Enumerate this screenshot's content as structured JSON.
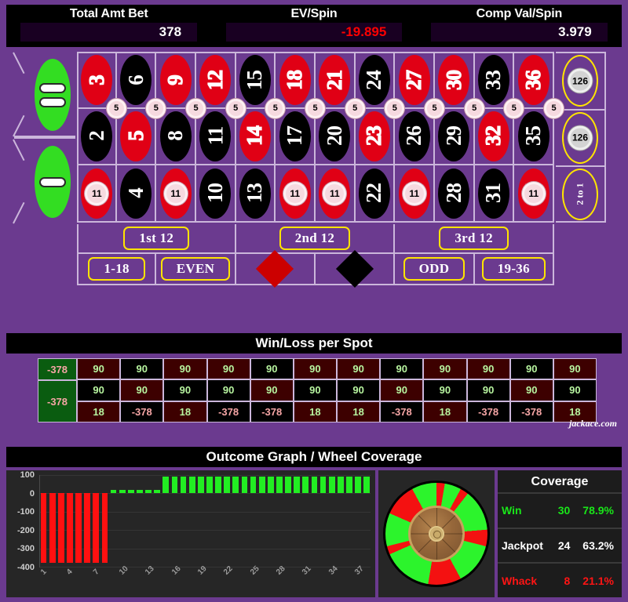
{
  "header": {
    "stats": [
      {
        "label": "Total Amt Bet",
        "value": "378",
        "negative": false
      },
      {
        "label": "EV/Spin",
        "value": "-19.895",
        "negative": true
      },
      {
        "label": "Comp Val/Spin",
        "value": "3.979",
        "negative": false
      }
    ]
  },
  "table": {
    "zeros": [
      {
        "name": "double-zero",
        "pips": 2
      },
      {
        "name": "single-zero",
        "pips": 1
      }
    ],
    "numbers": [
      {
        "n": "3",
        "color": "red",
        "chip": "5",
        "chipType": "split"
      },
      {
        "n": "6",
        "color": "black",
        "chip": "5",
        "chipType": "split"
      },
      {
        "n": "9",
        "color": "red",
        "chip": "5",
        "chipType": "split"
      },
      {
        "n": "12",
        "color": "red",
        "chip": "5",
        "chipType": "split"
      },
      {
        "n": "15",
        "color": "black",
        "chip": "5",
        "chipType": "split"
      },
      {
        "n": "18",
        "color": "red",
        "chip": "5",
        "chipType": "split"
      },
      {
        "n": "21",
        "color": "red",
        "chip": "5",
        "chipType": "split"
      },
      {
        "n": "24",
        "color": "black",
        "chip": "5",
        "chipType": "split"
      },
      {
        "n": "27",
        "color": "red",
        "chip": "5",
        "chipType": "split"
      },
      {
        "n": "30",
        "color": "red",
        "chip": "5",
        "chipType": "split"
      },
      {
        "n": "33",
        "color": "black",
        "chip": "5",
        "chipType": "split"
      },
      {
        "n": "36",
        "color": "red",
        "chip": "5",
        "chipType": "split"
      },
      {
        "n": "2",
        "color": "black",
        "chip": null,
        "chipType": null
      },
      {
        "n": "5",
        "color": "red",
        "chip": null,
        "chipType": null
      },
      {
        "n": "8",
        "color": "black",
        "chip": null,
        "chipType": null
      },
      {
        "n": "11",
        "color": "black",
        "chip": null,
        "chipType": null
      },
      {
        "n": "14",
        "color": "red",
        "chip": null,
        "chipType": null
      },
      {
        "n": "17",
        "color": "black",
        "chip": null,
        "chipType": null
      },
      {
        "n": "20",
        "color": "black",
        "chip": null,
        "chipType": null
      },
      {
        "n": "23",
        "color": "red",
        "chip": null,
        "chipType": null
      },
      {
        "n": "26",
        "color": "black",
        "chip": null,
        "chipType": null
      },
      {
        "n": "29",
        "color": "black",
        "chip": null,
        "chipType": null
      },
      {
        "n": "32",
        "color": "red",
        "chip": null,
        "chipType": null
      },
      {
        "n": "35",
        "color": "black",
        "chip": null,
        "chipType": null
      },
      {
        "n": "1",
        "color": "red",
        "chip": "11",
        "chipType": "center"
      },
      {
        "n": "4",
        "color": "black",
        "chip": null,
        "chipType": null
      },
      {
        "n": "7",
        "color": "red",
        "chip": "11",
        "chipType": "center"
      },
      {
        "n": "10",
        "color": "black",
        "chip": null,
        "chipType": null
      },
      {
        "n": "13",
        "color": "black",
        "chip": null,
        "chipType": null
      },
      {
        "n": "16",
        "color": "red",
        "chip": "11",
        "chipType": "center"
      },
      {
        "n": "19",
        "color": "red",
        "chip": "11",
        "chipType": "center"
      },
      {
        "n": "22",
        "color": "black",
        "chip": null,
        "chipType": null
      },
      {
        "n": "25",
        "color": "red",
        "chip": "11",
        "chipType": "center"
      },
      {
        "n": "28",
        "color": "black",
        "chip": null,
        "chipType": null
      },
      {
        "n": "31",
        "color": "black",
        "chip": null,
        "chipType": null
      },
      {
        "n": "34",
        "color": "red",
        "chip": "11",
        "chipType": "center"
      }
    ],
    "column_bets": [
      {
        "label": "2 to 1",
        "chip": "126"
      },
      {
        "label": "2 to 1",
        "chip": "126"
      },
      {
        "label": "2 to 1",
        "chip": null
      }
    ],
    "dozens": [
      {
        "label": "1st 12"
      },
      {
        "label": "2nd 12"
      },
      {
        "label": "3rd 12"
      }
    ],
    "outside": [
      {
        "label": "1-18",
        "type": "text"
      },
      {
        "label": "EVEN",
        "type": "text"
      },
      {
        "label": "RED",
        "type": "diamond-red"
      },
      {
        "label": "BLACK",
        "type": "diamond-black"
      },
      {
        "label": "ODD",
        "type": "text"
      },
      {
        "label": "19-36",
        "type": "text"
      }
    ]
  },
  "winloss": {
    "title": "Win/Loss per Spot",
    "zero_cells": [
      {
        "value": "-378"
      },
      {
        "value": "-378"
      }
    ],
    "columns": [
      {
        "cells": [
          {
            "value": "90",
            "color": "red",
            "sign": "pos"
          },
          {
            "value": "90",
            "color": "black",
            "sign": "pos"
          },
          {
            "value": "18",
            "color": "red",
            "sign": "pos"
          }
        ]
      },
      {
        "cells": [
          {
            "value": "90",
            "color": "black",
            "sign": "pos"
          },
          {
            "value": "90",
            "color": "red",
            "sign": "pos"
          },
          {
            "value": "-378",
            "color": "black",
            "sign": "neg"
          }
        ]
      },
      {
        "cells": [
          {
            "value": "90",
            "color": "red",
            "sign": "pos"
          },
          {
            "value": "90",
            "color": "black",
            "sign": "pos"
          },
          {
            "value": "18",
            "color": "red",
            "sign": "pos"
          }
        ]
      },
      {
        "cells": [
          {
            "value": "90",
            "color": "red",
            "sign": "pos"
          },
          {
            "value": "90",
            "color": "black",
            "sign": "pos"
          },
          {
            "value": "-378",
            "color": "black",
            "sign": "neg"
          }
        ]
      },
      {
        "cells": [
          {
            "value": "90",
            "color": "black",
            "sign": "pos"
          },
          {
            "value": "90",
            "color": "red",
            "sign": "pos"
          },
          {
            "value": "-378",
            "color": "black",
            "sign": "neg"
          }
        ]
      },
      {
        "cells": [
          {
            "value": "90",
            "color": "red",
            "sign": "pos"
          },
          {
            "value": "90",
            "color": "black",
            "sign": "pos"
          },
          {
            "value": "18",
            "color": "red",
            "sign": "pos"
          }
        ]
      },
      {
        "cells": [
          {
            "value": "90",
            "color": "red",
            "sign": "pos"
          },
          {
            "value": "90",
            "color": "black",
            "sign": "pos"
          },
          {
            "value": "18",
            "color": "red",
            "sign": "pos"
          }
        ]
      },
      {
        "cells": [
          {
            "value": "90",
            "color": "black",
            "sign": "pos"
          },
          {
            "value": "90",
            "color": "red",
            "sign": "pos"
          },
          {
            "value": "-378",
            "color": "black",
            "sign": "neg"
          }
        ]
      },
      {
        "cells": [
          {
            "value": "90",
            "color": "red",
            "sign": "pos"
          },
          {
            "value": "90",
            "color": "black",
            "sign": "pos"
          },
          {
            "value": "18",
            "color": "red",
            "sign": "pos"
          }
        ]
      },
      {
        "cells": [
          {
            "value": "90",
            "color": "red",
            "sign": "pos"
          },
          {
            "value": "90",
            "color": "black",
            "sign": "pos"
          },
          {
            "value": "-378",
            "color": "black",
            "sign": "neg"
          }
        ]
      },
      {
        "cells": [
          {
            "value": "90",
            "color": "black",
            "sign": "pos"
          },
          {
            "value": "90",
            "color": "red",
            "sign": "pos"
          },
          {
            "value": "-378",
            "color": "black",
            "sign": "neg"
          }
        ]
      },
      {
        "cells": [
          {
            "value": "90",
            "color": "red",
            "sign": "pos"
          },
          {
            "value": "90",
            "color": "black",
            "sign": "pos"
          },
          {
            "value": "18",
            "color": "red",
            "sign": "pos"
          }
        ]
      }
    ],
    "watermark": "jackace.com"
  },
  "outcome": {
    "title": "Outcome Graph / Wheel Coverage",
    "coverage": {
      "title": "Coverage",
      "rows": [
        {
          "name": "Win",
          "count": "30",
          "pct": "78.9%",
          "style": "c-win"
        },
        {
          "name": "Jackpot",
          "count": "24",
          "pct": "63.2%",
          "style": "c-jack"
        },
        {
          "name": "Whack",
          "count": "8",
          "pct": "21.1%",
          "style": "c-whack"
        }
      ]
    }
  },
  "chart_data": {
    "type": "bar",
    "title": "Outcome Graph",
    "xlabel": "",
    "ylabel": "",
    "ylim": [
      -400,
      100
    ],
    "yticks": [
      100,
      0,
      -100,
      -200,
      -300,
      -400
    ],
    "grid": true,
    "legend": "none",
    "xticks": [
      "1",
      "4",
      "7",
      "10",
      "13",
      "16",
      "19",
      "22",
      "25",
      "28",
      "31",
      "34",
      "37"
    ],
    "x": [
      1,
      2,
      3,
      4,
      5,
      6,
      7,
      8,
      9,
      10,
      11,
      12,
      13,
      14,
      15,
      16,
      17,
      18,
      19,
      20,
      21,
      22,
      23,
      24,
      25,
      26,
      27,
      28,
      29,
      30,
      31,
      32,
      33,
      34,
      35,
      36,
      37,
      38
    ],
    "values": [
      -378,
      -378,
      -378,
      -378,
      -378,
      -378,
      -378,
      -378,
      18,
      18,
      18,
      18,
      18,
      18,
      90,
      90,
      90,
      90,
      90,
      90,
      90,
      90,
      90,
      90,
      90,
      90,
      90,
      90,
      90,
      90,
      90,
      90,
      90,
      90,
      90,
      90,
      90,
      90
    ],
    "colors": [
      "red",
      "red",
      "red",
      "red",
      "red",
      "red",
      "red",
      "red",
      "green",
      "green",
      "green",
      "green",
      "green",
      "green",
      "green",
      "green",
      "green",
      "green",
      "green",
      "green",
      "green",
      "green",
      "green",
      "green",
      "green",
      "green",
      "green",
      "green",
      "green",
      "green",
      "green",
      "green",
      "green",
      "green",
      "green",
      "green",
      "green",
      "green"
    ]
  }
}
